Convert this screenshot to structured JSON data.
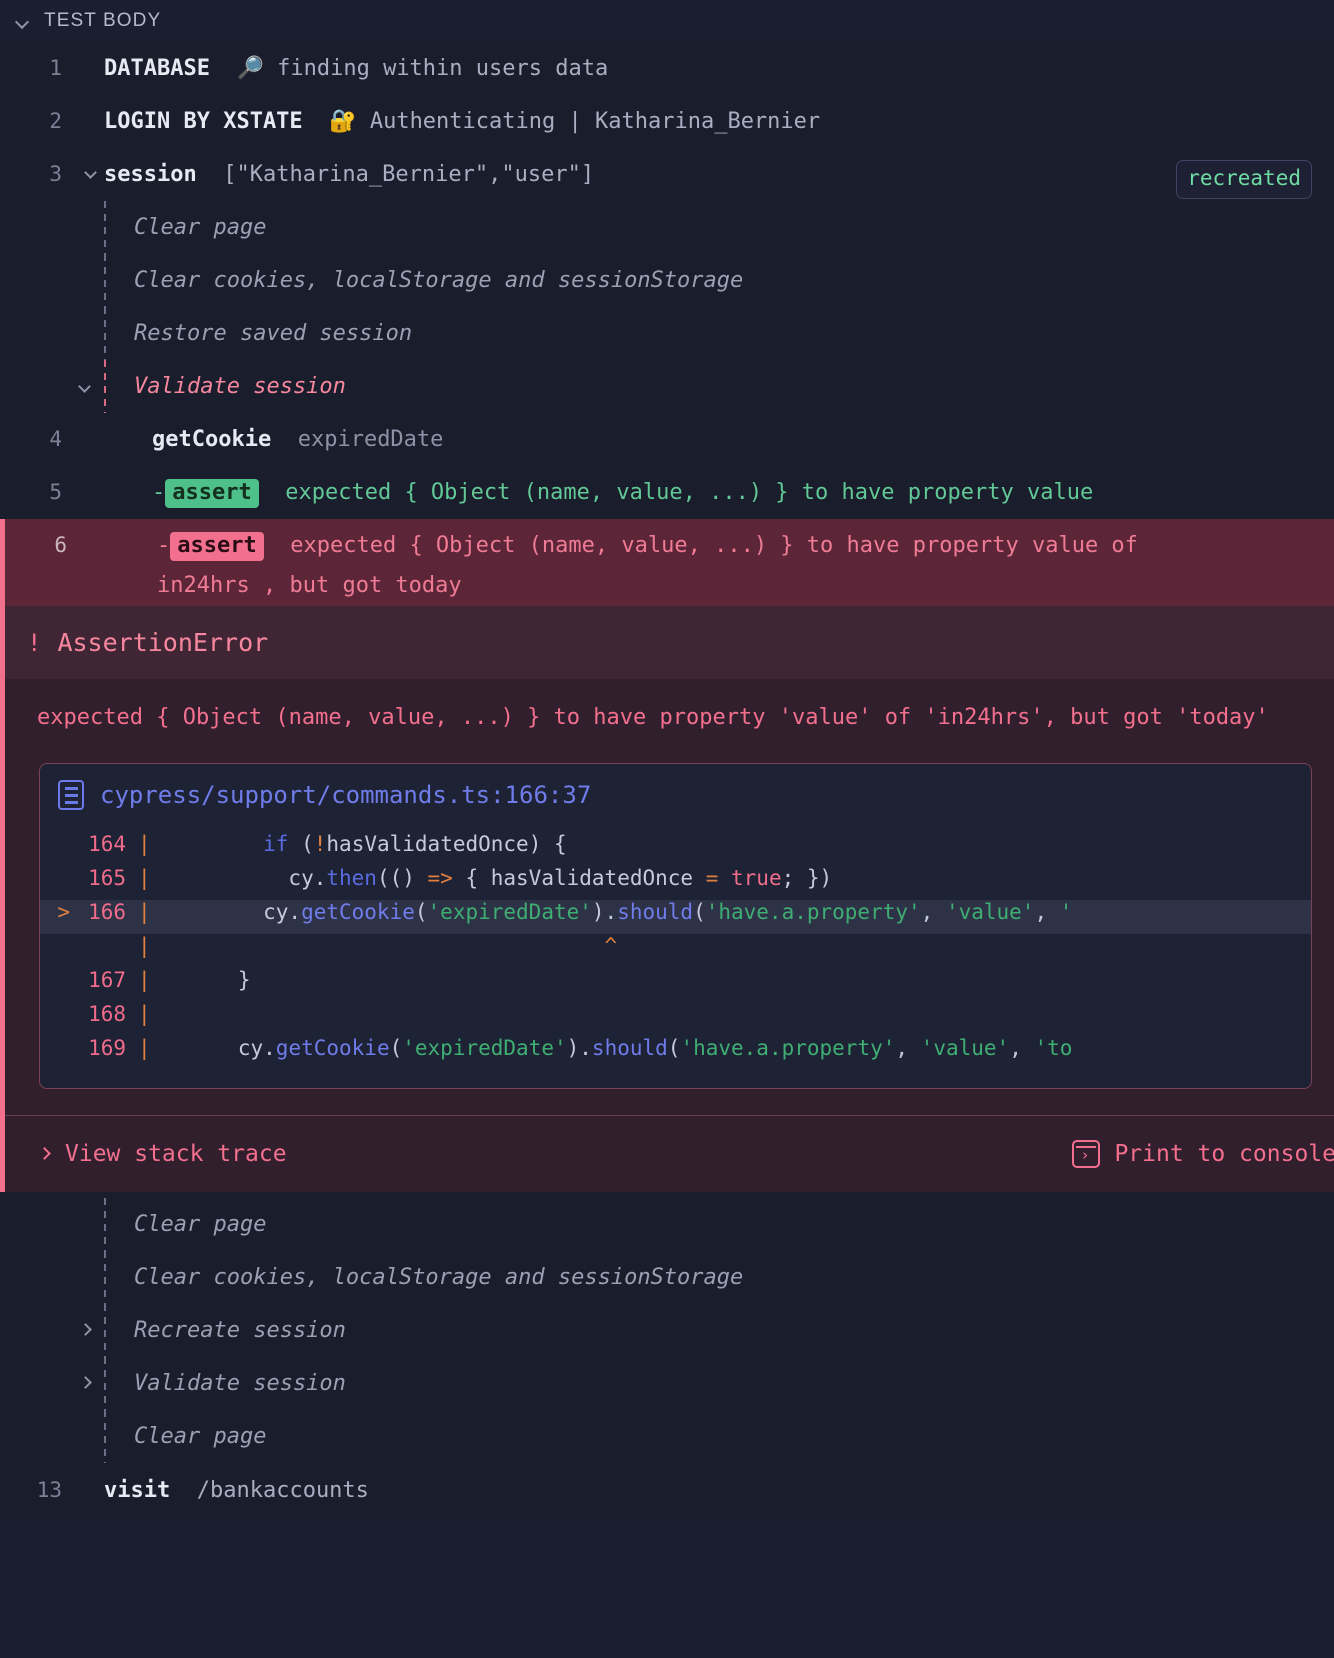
{
  "header": {
    "title": "TEST BODY",
    "collapse_icon": "chevron-down-icon"
  },
  "commands": [
    {
      "num": "1",
      "name": "DATABASE",
      "icon": "magnifier-emoji",
      "args": "finding within users data"
    },
    {
      "num": "2",
      "name": "LOGIN BY XSTATE",
      "icon": "lock-key-emoji",
      "args": "Authenticating | Katharina_Bernier"
    },
    {
      "num": "3",
      "name": "session",
      "args": "[\"Katharina_Bernier\",\"user\"]",
      "badge": "recreated"
    }
  ],
  "session_group": {
    "items": [
      {
        "label": "Clear page",
        "state": "normal",
        "toggle": "none"
      },
      {
        "label": "Clear cookies, localStorage and sessionStorage",
        "state": "normal",
        "toggle": "none"
      },
      {
        "label": "Restore saved session",
        "state": "normal",
        "toggle": "none"
      },
      {
        "label": "Validate session",
        "state": "error",
        "toggle": "down"
      }
    ],
    "inner": [
      {
        "num": "4",
        "type": "command",
        "name": "getCookie",
        "args": "expiredDate"
      },
      {
        "num": "5",
        "type": "assert",
        "status": "passed",
        "chip": "assert",
        "text": "expected { Object (name, value, ...) } to have property value"
      },
      {
        "num": "6",
        "type": "assert",
        "status": "failed",
        "chip": "assert",
        "text": "expected { Object (name, value, ...) } to have property value of in24hrs , but got today",
        "line1": "expected { Object (name, value, ...) } to have property value of",
        "line2_prefix": "in24hrs ,",
        "line2_mid": "but got",
        "line2_suffix": "today"
      }
    ]
  },
  "error_panel": {
    "bang": "!",
    "title": "AssertionError",
    "message": "expected { Object (name, value, ...) } to have property 'value' of 'in24hrs', but got 'today'",
    "code_card": {
      "file_icon": "file-lines-icon",
      "file_path": "cypress/support/commands.ts:166:37",
      "lines": [
        {
          "marker": "",
          "num": "164",
          "pipe": "|",
          "highlight": false,
          "tokens": [
            {
              "t": "        ",
              "c": "punc"
            },
            {
              "t": "if",
              "c": "kw"
            },
            {
              "t": " (",
              "c": "punc"
            },
            {
              "t": "!",
              "c": "bang"
            },
            {
              "t": "hasValidatedOnce) {",
              "c": "punc"
            }
          ]
        },
        {
          "marker": "",
          "num": "165",
          "pipe": "|",
          "highlight": false,
          "tokens": [
            {
              "t": "          cy.",
              "c": "punc"
            },
            {
              "t": "then",
              "c": "kw"
            },
            {
              "t": "(() ",
              "c": "punc"
            },
            {
              "t": "=>",
              "c": "op"
            },
            {
              "t": " { hasValidatedOnce ",
              "c": "punc"
            },
            {
              "t": "=",
              "c": "op"
            },
            {
              "t": " ",
              "c": "punc"
            },
            {
              "t": "true",
              "c": "bool"
            },
            {
              "t": "; })",
              "c": "punc"
            }
          ]
        },
        {
          "marker": ">",
          "num": "166",
          "pipe": "|",
          "highlight": true,
          "tokens": [
            {
              "t": "        cy.",
              "c": "punc"
            },
            {
              "t": "getCookie",
              "c": "fn"
            },
            {
              "t": "(",
              "c": "punc"
            },
            {
              "t": "'expiredDate'",
              "c": "str"
            },
            {
              "t": ").",
              "c": "punc"
            },
            {
              "t": "should",
              "c": "fn"
            },
            {
              "t": "(",
              "c": "punc"
            },
            {
              "t": "'have.a.property'",
              "c": "str"
            },
            {
              "t": ", ",
              "c": "punc"
            },
            {
              "t": "'value'",
              "c": "str"
            },
            {
              "t": ", ",
              "c": "punc"
            },
            {
              "t": "'",
              "c": "str"
            }
          ]
        },
        {
          "marker": "",
          "num": "",
          "pipe": "|",
          "highlight": false,
          "caret": "^",
          "tokens": []
        },
        {
          "marker": "",
          "num": "167",
          "pipe": "|",
          "highlight": false,
          "tokens": [
            {
              "t": "      }",
              "c": "punc"
            }
          ]
        },
        {
          "marker": "",
          "num": "168",
          "pipe": "|",
          "highlight": false,
          "tokens": []
        },
        {
          "marker": "",
          "num": "169",
          "pipe": "|",
          "highlight": false,
          "tokens": [
            {
              "t": "      cy.",
              "c": "punc"
            },
            {
              "t": "getCookie",
              "c": "fn"
            },
            {
              "t": "(",
              "c": "punc"
            },
            {
              "t": "'expiredDate'",
              "c": "str"
            },
            {
              "t": ").",
              "c": "punc"
            },
            {
              "t": "should",
              "c": "fn"
            },
            {
              "t": "(",
              "c": "punc"
            },
            {
              "t": "'have.a.property'",
              "c": "str"
            },
            {
              "t": ", ",
              "c": "punc"
            },
            {
              "t": "'value'",
              "c": "str"
            },
            {
              "t": ", ",
              "c": "punc"
            },
            {
              "t": "'to",
              "c": "str"
            }
          ]
        }
      ]
    },
    "footer": {
      "stack_trace_label": "View stack trace",
      "stack_trace_icon": "chevron-right-icon",
      "print_console_label": "Print to console",
      "print_console_icon": "console-icon"
    }
  },
  "bottom_group": {
    "items": [
      {
        "label": "Clear page",
        "toggle": "none"
      },
      {
        "label": "Clear cookies, localStorage and sessionStorage",
        "toggle": "none"
      },
      {
        "label": "Recreate session",
        "toggle": "right"
      },
      {
        "label": "Validate session",
        "toggle": "right"
      },
      {
        "label": "Clear page",
        "toggle": "none"
      }
    ]
  },
  "last_command": {
    "num": "13",
    "name": "visit",
    "args": "/bankaccounts"
  },
  "colors": {
    "background": "#1a1d2b",
    "pass_green": "#4ec08a",
    "fail_pink": "#f2708e",
    "error_bg": "#321f2d",
    "failed_row_bg": "#5d2638",
    "link_blue": "#6f7ce9",
    "accent_orange": "#e0803f"
  }
}
